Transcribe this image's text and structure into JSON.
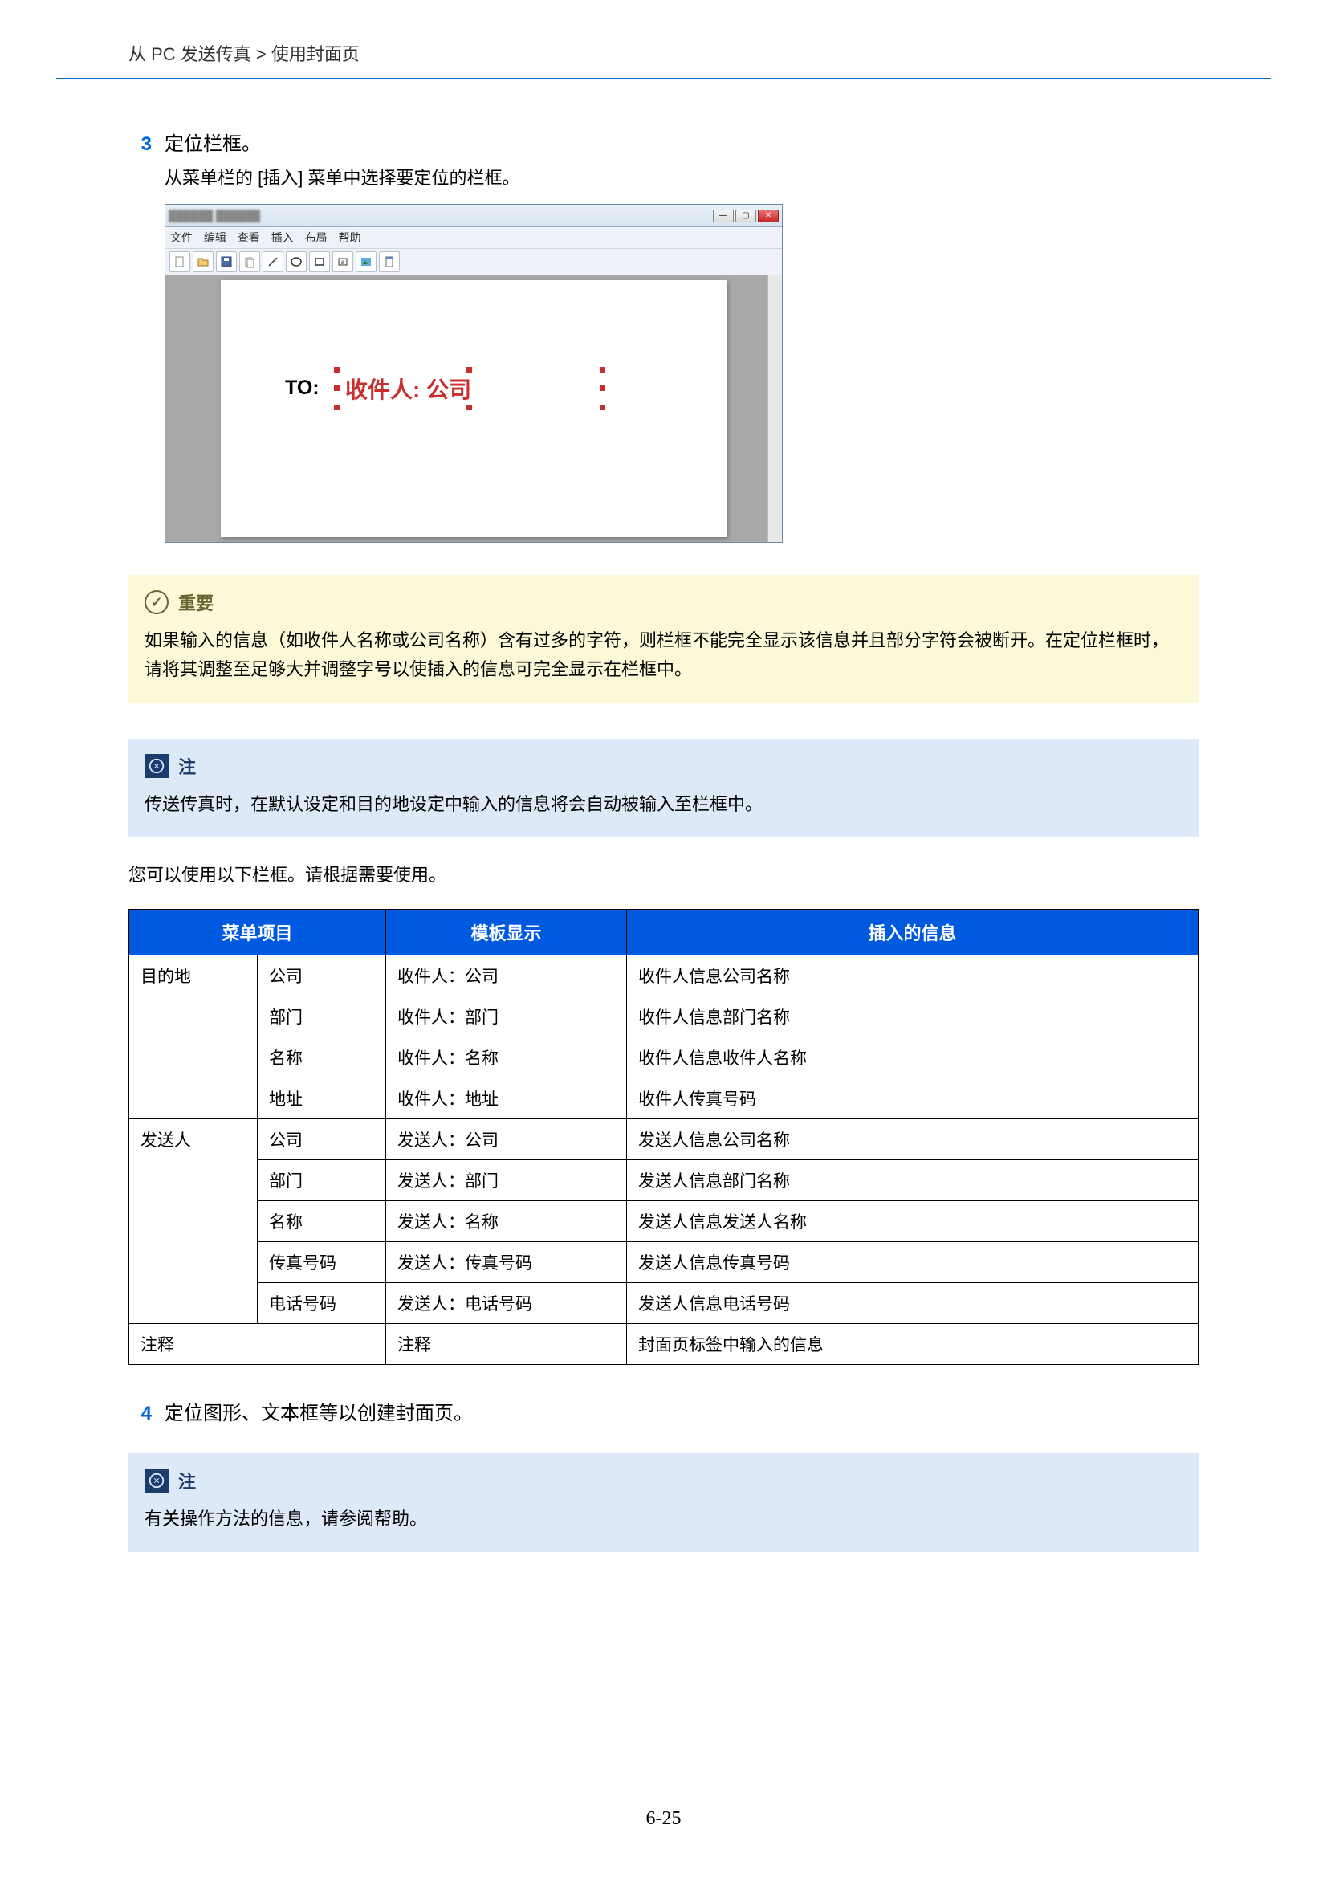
{
  "breadcrumb": "从 PC 发送传真 > 使用封面页",
  "step3": {
    "num": "3",
    "title": "定位栏框。",
    "sub": "从菜单栏的 [插入] 菜单中选择要定位的栏框。"
  },
  "window": {
    "menus": [
      "文件",
      "编辑",
      "查看",
      "插入",
      "布局",
      "帮助"
    ],
    "field_label": "TO:",
    "field_value": "收件人: 公司"
  },
  "important": {
    "title": "重要",
    "body": "如果输入的信息（如收件人名称或公司名称）含有过多的字符，则栏框不能完全显示该信息并且部分字符会被断开。在定位栏框时，请将其调整至足够大并调整字号以使插入的信息可完全显示在栏框中。"
  },
  "note1": {
    "title": "注",
    "body": "传送传真时，在默认设定和目的地设定中输入的信息将会自动被输入至栏框中。"
  },
  "table_intro": "您可以使用以下栏框。请根据需要使用。",
  "table": {
    "headers": [
      "菜单项目",
      "模板显示",
      "插入的信息"
    ],
    "sections": [
      {
        "group": "目的地",
        "rows": [
          [
            "公司",
            "收件人：公司",
            "收件人信息公司名称"
          ],
          [
            "部门",
            "收件人：部门",
            "收件人信息部门名称"
          ],
          [
            "名称",
            "收件人：名称",
            "收件人信息收件人名称"
          ],
          [
            "地址",
            "收件人：地址",
            "收件人传真号码"
          ]
        ]
      },
      {
        "group": "发送人",
        "rows": [
          [
            "公司",
            "发送人：公司",
            "发送人信息公司名称"
          ],
          [
            "部门",
            "发送人：部门",
            "发送人信息部门名称"
          ],
          [
            "名称",
            "发送人：名称",
            "发送人信息发送人名称"
          ],
          [
            "传真号码",
            "发送人：传真号码",
            "发送人信息传真号码"
          ],
          [
            "电话号码",
            "发送人：电话号码",
            "发送人信息电话号码"
          ]
        ]
      },
      {
        "group": "注释",
        "single": true,
        "rows": [
          [
            "",
            "注释",
            "封面页标签中输入的信息"
          ]
        ]
      }
    ]
  },
  "step4": {
    "num": "4",
    "title": "定位图形、文本框等以创建封面页。"
  },
  "note2": {
    "title": "注",
    "body": "有关操作方法的信息，请参阅帮助。"
  },
  "page_number": "6-25"
}
